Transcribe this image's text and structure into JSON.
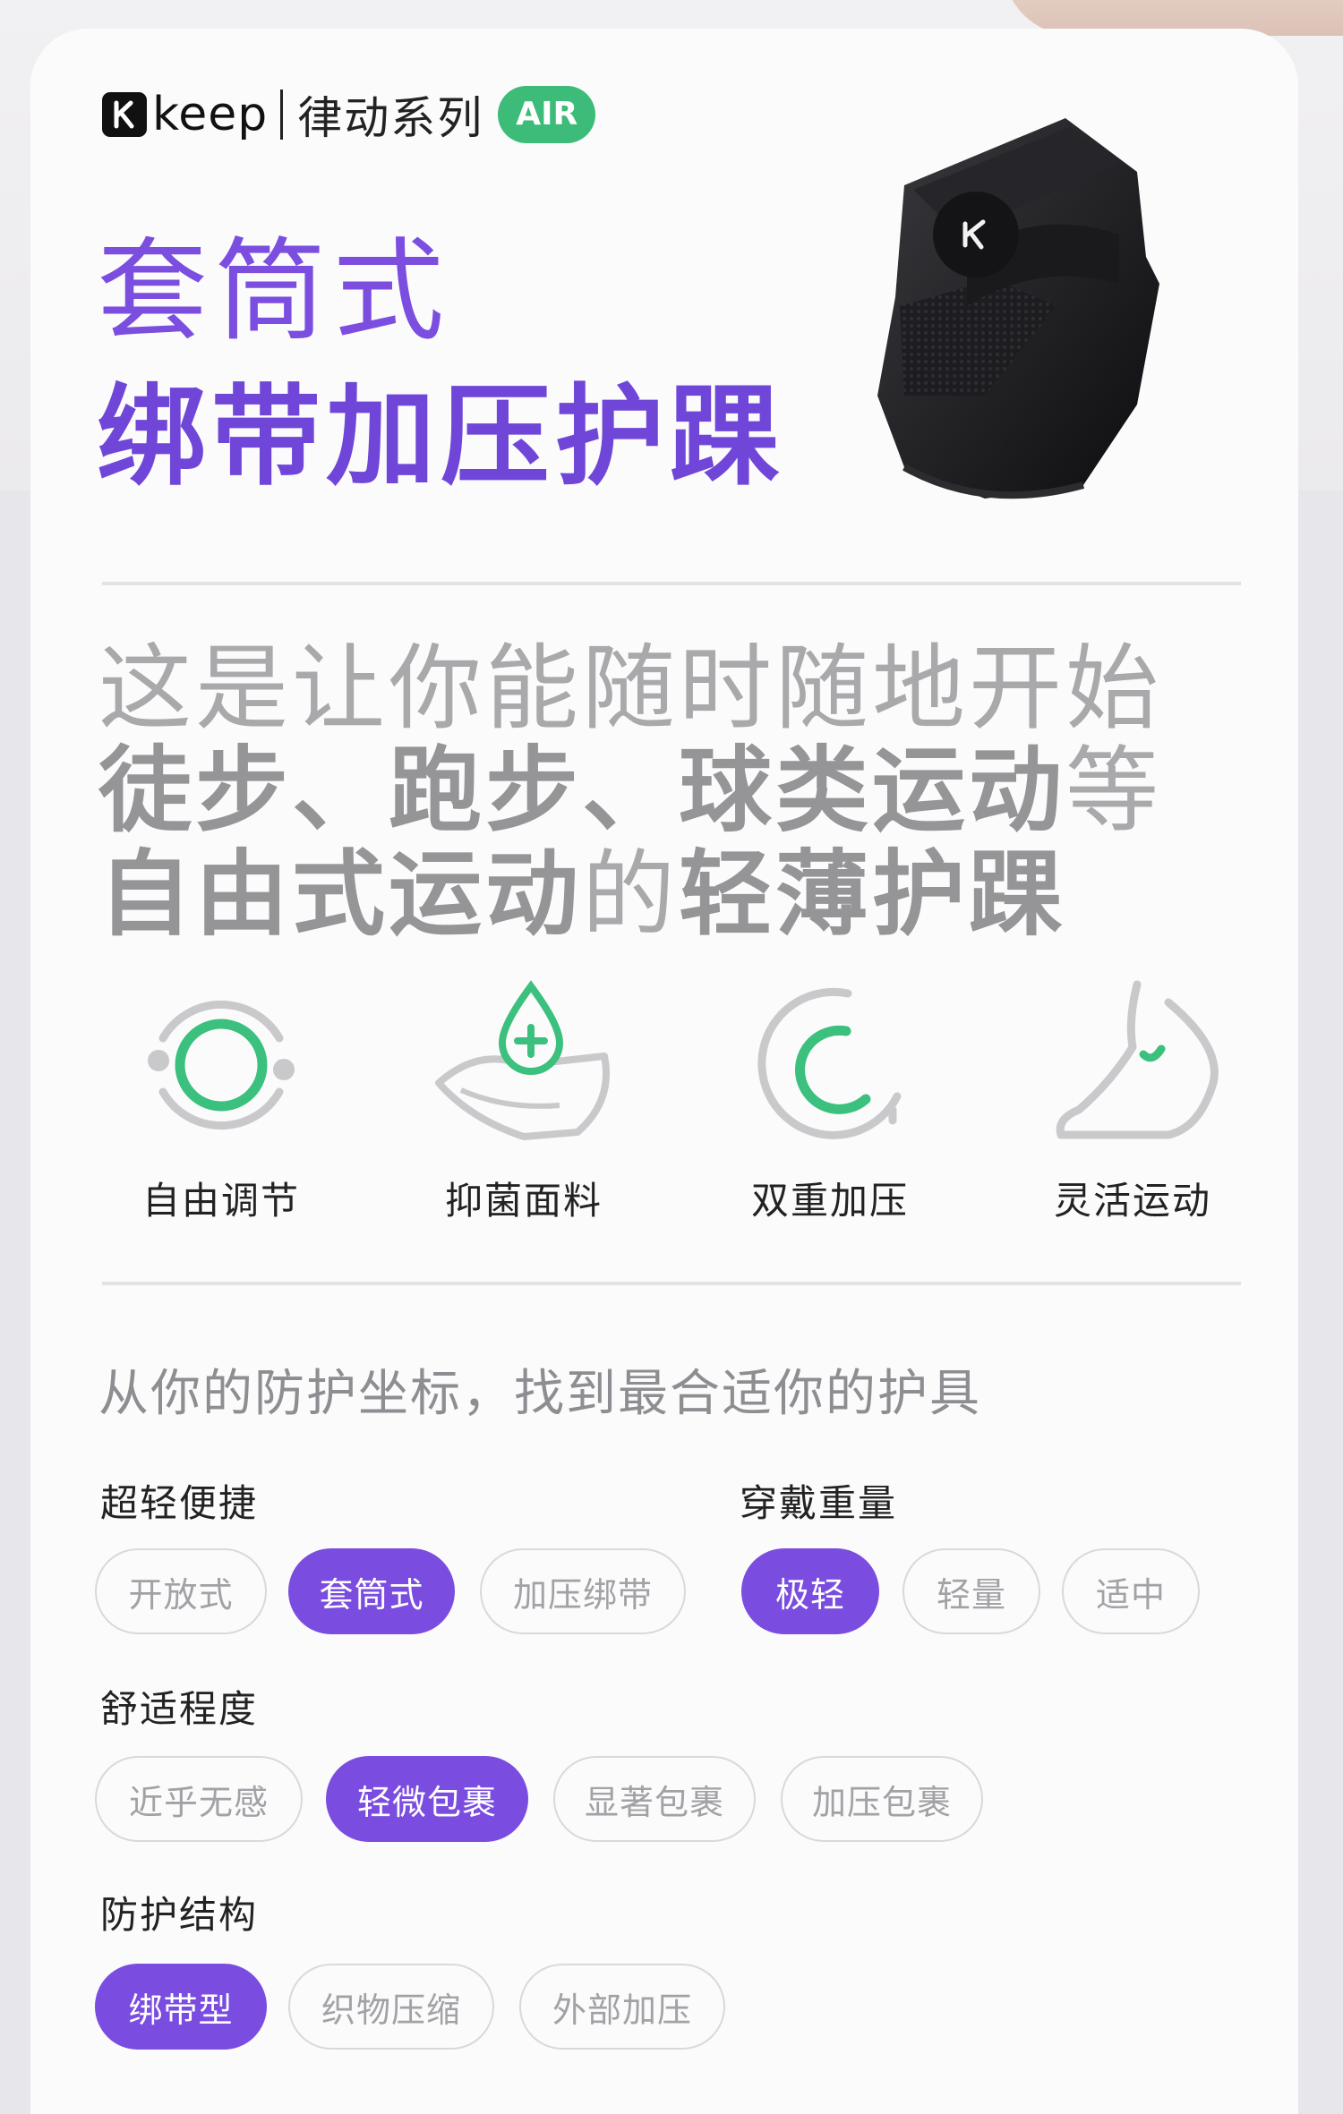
{
  "header": {
    "brand": "keep",
    "series": "律动系列",
    "badge": "AIR"
  },
  "title": {
    "line1": "套筒式",
    "line2": "绑带加压护踝"
  },
  "tagline": {
    "line1": "这是让你能随时随地开始",
    "line2_bold": "徒步、跑步、球类运动",
    "line2_thin": "等",
    "line3_bold": "自由式运动",
    "line3_thin": "的",
    "line3_bold2": "轻薄护踝"
  },
  "features": [
    {
      "icon": "adjust-ring-icon",
      "label": "自由调节"
    },
    {
      "icon": "antibacterial-drop-icon",
      "label": "抑菌面料"
    },
    {
      "icon": "double-compression-icon",
      "label": "双重加压"
    },
    {
      "icon": "foot-motion-icon",
      "label": "灵活运动"
    }
  ],
  "coordinate_title": "从你的防护坐标，找到最合适你的护具",
  "categories": {
    "lightweight": {
      "label": "超轻便捷",
      "options": [
        "开放式",
        "套筒式",
        "加压绑带"
      ],
      "selected": "套筒式"
    },
    "weight": {
      "label": "穿戴重量",
      "options": [
        "极轻",
        "轻量",
        "适中"
      ],
      "selected": "极轻"
    },
    "comfort": {
      "label": "舒适程度",
      "options": [
        "近乎无感",
        "轻微包裹",
        "显著包裹",
        "加压包裹"
      ],
      "selected": "轻微包裹"
    },
    "structure": {
      "label": "防护结构",
      "options": [
        "绑带型",
        "织物压缩",
        "外部加压"
      ],
      "selected": "绑带型"
    }
  },
  "colors": {
    "accent_purple": "#7a4de0",
    "badge_green": "#3dbb78",
    "icon_green": "#3cc07d",
    "icon_gray": "#c9c9cc"
  }
}
